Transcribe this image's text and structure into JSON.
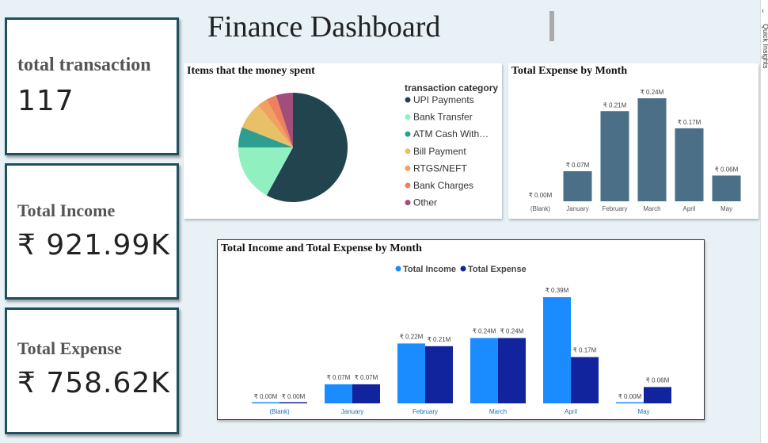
{
  "header": {
    "title": "Finance Dashboard"
  },
  "side_pane": {
    "label": "Quick Insights",
    "arrow": "‹"
  },
  "kpis": [
    {
      "label": "total transaction",
      "value": "117"
    },
    {
      "label": "Total Income",
      "value": "₹ 921.99K"
    },
    {
      "label": "Total Expense",
      "value": "₹ 758.62K"
    }
  ],
  "chart_data": [
    {
      "type": "pie",
      "title": "Items that the money spent",
      "legend_title": "transaction category",
      "legend_position": "right",
      "categories": [
        "UPI Payments",
        "Bank Transfer",
        "ATM Cash With…",
        "Bill Payment",
        "RTGS/NEFT",
        "Bank Charges",
        "Other"
      ],
      "values": [
        58,
        17,
        6,
        8,
        3,
        3,
        5
      ],
      "colors": [
        "#22444f",
        "#90f0c0",
        "#2e9e8e",
        "#e8c068",
        "#f0a060",
        "#ee8060",
        "#a34d7a"
      ]
    },
    {
      "type": "bar",
      "title": "Total Expense by Month",
      "categories": [
        "(Blank)",
        "January",
        "February",
        "March",
        "April",
        "May"
      ],
      "values": [
        0.0,
        0.07,
        0.21,
        0.24,
        0.17,
        0.06
      ],
      "data_labels": [
        "₹ 0.00M",
        "₹ 0.07M",
        "₹ 0.21M",
        "₹ 0.24M",
        "₹ 0.17M",
        "₹ 0.06M"
      ],
      "color": "#4a6f86",
      "ylim": [
        0,
        0.24
      ]
    },
    {
      "type": "bar",
      "title": "Total Income and Total Expense by Month",
      "legend_position": "top",
      "categories": [
        "(Blank)",
        "January",
        "February",
        "March",
        "April",
        "May"
      ],
      "series": [
        {
          "name": "Total Income",
          "color": "#1a8cff",
          "values": [
            0.0,
            0.07,
            0.22,
            0.24,
            0.39,
            0.0
          ],
          "data_labels": [
            "₹ 0.00M",
            "₹ 0.07M",
            "₹ 0.22M",
            "₹ 0.24M",
            "₹ 0.39M",
            "₹ 0.00M"
          ]
        },
        {
          "name": "Total Expense",
          "color": "#12239e",
          "values": [
            0.0,
            0.07,
            0.21,
            0.24,
            0.17,
            0.06
          ],
          "data_labels": [
            "₹ 0.00M",
            "₹ 0.07M",
            "₹ 0.21M",
            "₹ 0.24M",
            "₹ 0.17M",
            "₹ 0.06M"
          ]
        }
      ],
      "ylim": [
        0,
        0.39
      ]
    }
  ]
}
